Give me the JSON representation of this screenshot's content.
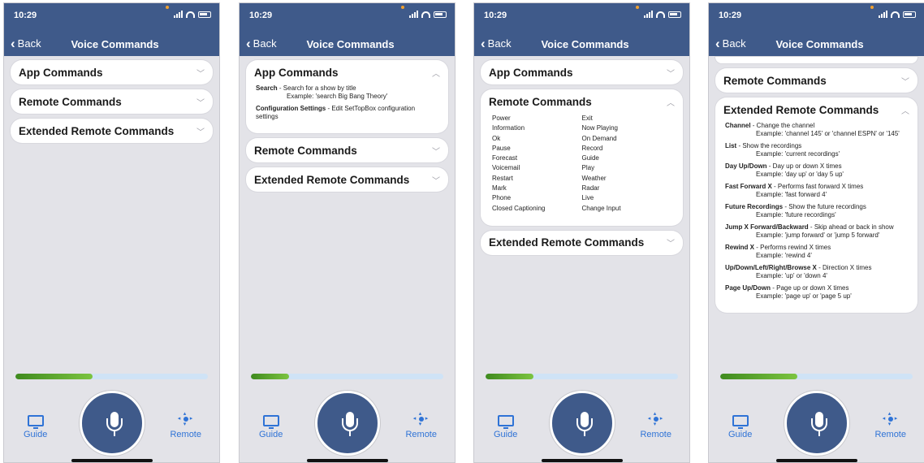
{
  "status": {
    "time": "10:29"
  },
  "nav": {
    "back_label": "Back",
    "title": "Voice Commands"
  },
  "sections": {
    "app": "App Commands",
    "remote": "Remote Commands",
    "extended": "Extended Remote Commands"
  },
  "app_commands": [
    {
      "name": "Search",
      "desc": " - Search for a show by title",
      "example": "Example: 'search Big Bang Theory'"
    },
    {
      "name": "Configuration Settings",
      "desc": " - Edit SetTopBox configuration settings",
      "example": ""
    }
  ],
  "remote_commands": {
    "left": [
      "Power",
      "Information",
      "Ok",
      "Pause",
      "Forecast",
      "Voicemail",
      "Restart",
      "Mark",
      "Phone",
      "Closed Captioning"
    ],
    "right": [
      "Exit",
      "Now Playing",
      "On Demand",
      "Record",
      "Guide",
      "Play",
      "Weather",
      "Radar",
      "Live",
      "Change Input"
    ]
  },
  "extended_commands": [
    {
      "name": "Channel",
      "desc": " - Change the channel",
      "example": "Example: 'channel 145' or 'channel ESPN' or '145'"
    },
    {
      "name": "List",
      "desc": " - Show the recordings",
      "example": "Example: 'current recordings'"
    },
    {
      "name": "Day Up/Down",
      "desc": " - Day up or down X times",
      "example": "Example: 'day up' or 'day 5 up'"
    },
    {
      "name": "Fast Forward X",
      "desc": " - Performs fast forward X times",
      "example": "Example: 'fast forward 4'"
    },
    {
      "name": "Future Recordings",
      "desc": " - Show the future recordings",
      "example": "Example: 'future recordings'"
    },
    {
      "name": "Jump X Forward/Backward",
      "desc": " - Skip ahead or back in show",
      "example": "Example: 'jump forward' or 'jump 5 forward'"
    },
    {
      "name": "Rewind X",
      "desc": " - Performs rewind X times",
      "example": "Example: 'rewind 4'"
    },
    {
      "name": "Up/Down/Left/Right/Browse X",
      "desc": " - Direction X times",
      "example": "Example: 'up' or 'down 4'"
    },
    {
      "name": "Page Up/Down",
      "desc": " - Page up or down X times",
      "example": "Example: 'page up' or 'page 5 up'"
    }
  ],
  "tabs": {
    "guide": "Guide",
    "remote": "Remote"
  },
  "progress": [
    0.4,
    0.2,
    0.25,
    0.4
  ],
  "colors": {
    "header": "#3f5a8a",
    "accent": "#2f73d6",
    "progress_fill": "#5aa82e",
    "progress_track": "#cfe3f6"
  },
  "icons": {
    "back": "chevron-left-icon",
    "guide": "tv-icon",
    "remote": "dpad-icon",
    "mic": "microphone-icon",
    "collapse": "chevron-up-icon",
    "expand": "chevron-down-icon"
  }
}
